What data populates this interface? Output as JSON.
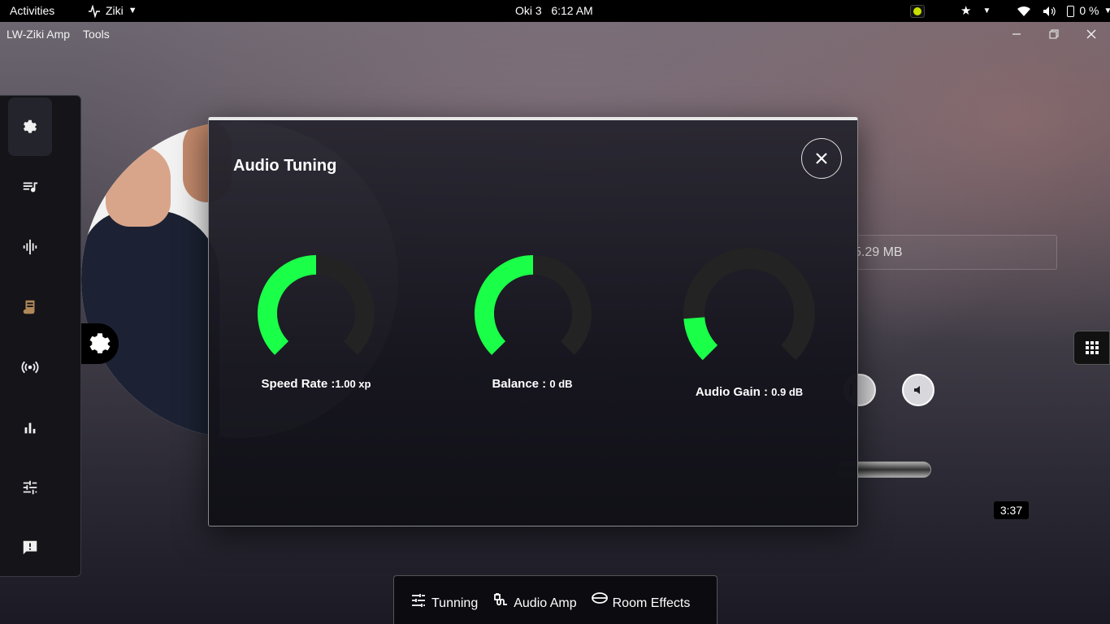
{
  "topbar": {
    "activities": "Activities",
    "app_name": "Ziki",
    "clock": "Oki 3   6:12 AM",
    "battery": "0 %"
  },
  "window": {
    "menu": [
      "LW-Ziki Amp",
      "Tools"
    ]
  },
  "player": {
    "file_size": "5.29 MB",
    "duration": "3:37"
  },
  "dialog": {
    "title": "Audio Tuning",
    "knobs": [
      {
        "label": "Speed Rate :",
        "value": "1.00 xp",
        "level": 0.5
      },
      {
        "label": "Balance : ",
        "value": "0 dB",
        "level": 0.5
      },
      {
        "label": "Audio Gain : ",
        "value": "0.9 dB",
        "level": 0.15
      }
    ]
  },
  "tabs": [
    {
      "label": "Tunning",
      "icon": "sliders-icon"
    },
    {
      "label": "Audio Amp",
      "icon": "plug-icon"
    },
    {
      "label": "Room Effects",
      "icon": "ring-icon"
    }
  ],
  "colors": {
    "accent": "#1aff48",
    "track": "#232323"
  }
}
